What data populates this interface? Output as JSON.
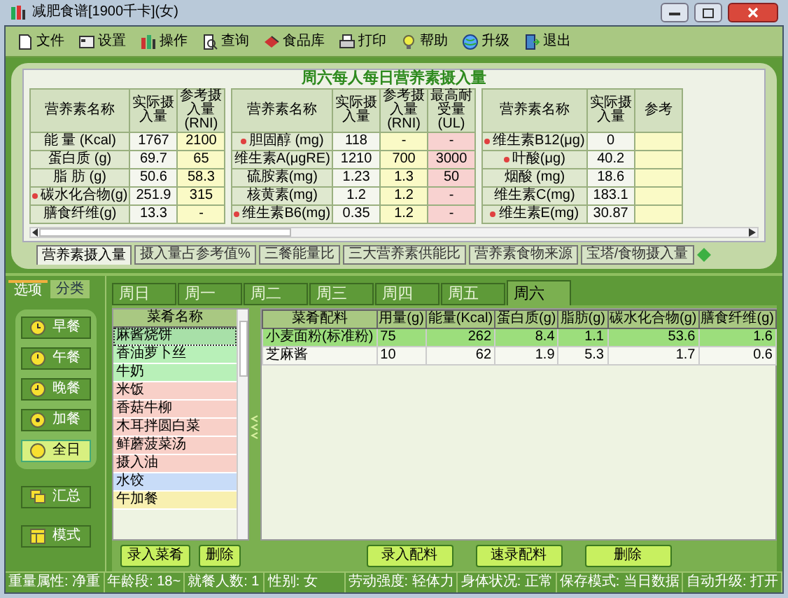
{
  "window": {
    "title": "减肥食谱[1900千卡](女)"
  },
  "menu": [
    "文件",
    "设置",
    "操作",
    "查询",
    "食品库",
    "打印",
    "帮助",
    "升级",
    "退出"
  ],
  "summary": {
    "title": "周六每人每日营养素摄入量",
    "tables": [
      {
        "columns": [
          {
            "label": "营养素名称",
            "kind": "name"
          },
          {
            "label": "实际摄入量",
            "kind": "actual"
          },
          {
            "label": "参考摄入量(RNI)",
            "kind": "reference"
          }
        ],
        "rows": [
          {
            "flagged": false,
            "cells": [
              "能 量 (Kcal)",
              "1767",
              "2100"
            ]
          },
          {
            "flagged": false,
            "cells": [
              "蛋白质 (g)",
              "69.7",
              "65"
            ]
          },
          {
            "flagged": false,
            "cells": [
              "脂 肪 (g)",
              "50.6",
              "58.3"
            ]
          },
          {
            "flagged": true,
            "cells": [
              "碳水化合物(g)",
              "251.9",
              "315"
            ]
          },
          {
            "flagged": false,
            "cells": [
              "膳食纤维(g)",
              "13.3",
              "-"
            ]
          }
        ]
      },
      {
        "columns": [
          {
            "label": "营养素名称",
            "kind": "name"
          },
          {
            "label": "实际摄入量",
            "kind": "actual"
          },
          {
            "label": "参考摄入量(RNI)",
            "kind": "reference"
          },
          {
            "label": "最高耐受量(UL)",
            "kind": "limit"
          }
        ],
        "rows": [
          {
            "flagged": true,
            "cells": [
              "胆固醇 (mg)",
              "118",
              "-",
              "-"
            ]
          },
          {
            "flagged": false,
            "cells": [
              "维生素A(μgRE)",
              "1210",
              "700",
              "3000"
            ]
          },
          {
            "flagged": false,
            "cells": [
              "硫胺素(mg)",
              "1.23",
              "1.3",
              "50"
            ]
          },
          {
            "flagged": false,
            "cells": [
              "核黄素(mg)",
              "1.2",
              "1.2",
              "-"
            ]
          },
          {
            "flagged": true,
            "cells": [
              "维生素B6(mg)",
              "0.35",
              "1.2",
              "-"
            ]
          }
        ]
      },
      {
        "columns": [
          {
            "label": "营养素名称",
            "kind": "name"
          },
          {
            "label": "实际摄入量",
            "kind": "actual"
          },
          {
            "label": "参考",
            "kind": "reference"
          }
        ],
        "rows": [
          {
            "flagged": true,
            "cells": [
              "维生素B12(μg)",
              "0"
            ]
          },
          {
            "flagged": true,
            "cells": [
              "叶酸(μg)",
              "40.2"
            ]
          },
          {
            "flagged": false,
            "cells": [
              "烟酸 (mg)",
              "18.6"
            ]
          },
          {
            "flagged": false,
            "cells": [
              "维生素C(mg)",
              "183.1"
            ]
          },
          {
            "flagged": true,
            "cells": [
              "维生素E(mg)",
              "30.87"
            ]
          }
        ]
      }
    ],
    "tabs": [
      {
        "label": "营养素摄入量",
        "selected": true
      },
      {
        "label": "摄入量占参考值%",
        "selected": false
      },
      {
        "label": "三餐能量比",
        "selected": false
      },
      {
        "label": "三大营养素供能比",
        "selected": false
      },
      {
        "label": "营养素食物来源",
        "selected": false
      },
      {
        "label": "宝塔/食物摄入量",
        "selected": false
      }
    ]
  },
  "sidebar": {
    "tabs": [
      {
        "label": "选项",
        "selected": true
      },
      {
        "label": "分类",
        "selected": false
      }
    ],
    "meals": [
      {
        "label": "早餐",
        "selected": false
      },
      {
        "label": "午餐",
        "selected": false
      },
      {
        "label": "晚餐",
        "selected": false
      },
      {
        "label": "加餐",
        "selected": false
      },
      {
        "label": "全日",
        "selected": true
      }
    ],
    "tools": [
      "汇总",
      "模式"
    ]
  },
  "day_tabs": [
    {
      "label": "周日",
      "selected": false
    },
    {
      "label": "周一",
      "selected": false
    },
    {
      "label": "周二",
      "selected": false
    },
    {
      "label": "周三",
      "selected": false
    },
    {
      "label": "周四",
      "selected": false
    },
    {
      "label": "周五",
      "selected": false
    },
    {
      "label": "周六",
      "selected": true
    }
  ],
  "dishes": {
    "header": "菜肴名称",
    "items": [
      {
        "name": "麻酱烧饼",
        "color": "#a8e0a8",
        "selected": true
      },
      {
        "name": "香油萝卜丝",
        "color": "#b8f0b8",
        "selected": false
      },
      {
        "name": "牛奶",
        "color": "#b8f0b8",
        "selected": false
      },
      {
        "name": "米饭",
        "color": "#f8d0c8",
        "selected": false
      },
      {
        "name": "香菇牛柳",
        "color": "#f8d0c8",
        "selected": false
      },
      {
        "name": "木耳拌圆白菜",
        "color": "#f8d0c8",
        "selected": false
      },
      {
        "name": "鲜蘑菠菜汤",
        "color": "#f8d0c8",
        "selected": false
      },
      {
        "name": "摄入油",
        "color": "#f8d0c8",
        "selected": false
      },
      {
        "name": "水饺",
        "color": "#c8dcf8",
        "selected": false
      },
      {
        "name": "午加餐",
        "color": "#f8f0b0",
        "selected": false
      }
    ],
    "buttons": [
      "录入菜肴",
      "删除"
    ]
  },
  "ingredients": {
    "columns": [
      "菜肴配料",
      "用量(g)",
      "能量(Kcal)",
      "蛋白质(g)",
      "脂肪(g)",
      "碳水化合物(g)",
      "膳食纤维(g)"
    ],
    "rows": [
      {
        "selected": true,
        "cells": [
          "小麦面粉(标准粉)",
          "75",
          "262",
          "8.4",
          "1.1",
          "53.6",
          "1.6"
        ]
      },
      {
        "selected": false,
        "cells": [
          "芝麻酱",
          "10",
          "62",
          "1.9",
          "5.3",
          "1.7",
          "0.6"
        ]
      }
    ],
    "buttons": [
      "录入配料",
      "速录配料",
      "删除"
    ]
  },
  "status_bar": [
    "重量属性: 净重",
    "年龄段: 18~",
    "就餐人数: 1",
    "性别: 女",
    "劳动强度: 轻体力",
    "身体状况: 正常",
    "保存模式: 当日数据",
    "自动升级: 打开"
  ]
}
